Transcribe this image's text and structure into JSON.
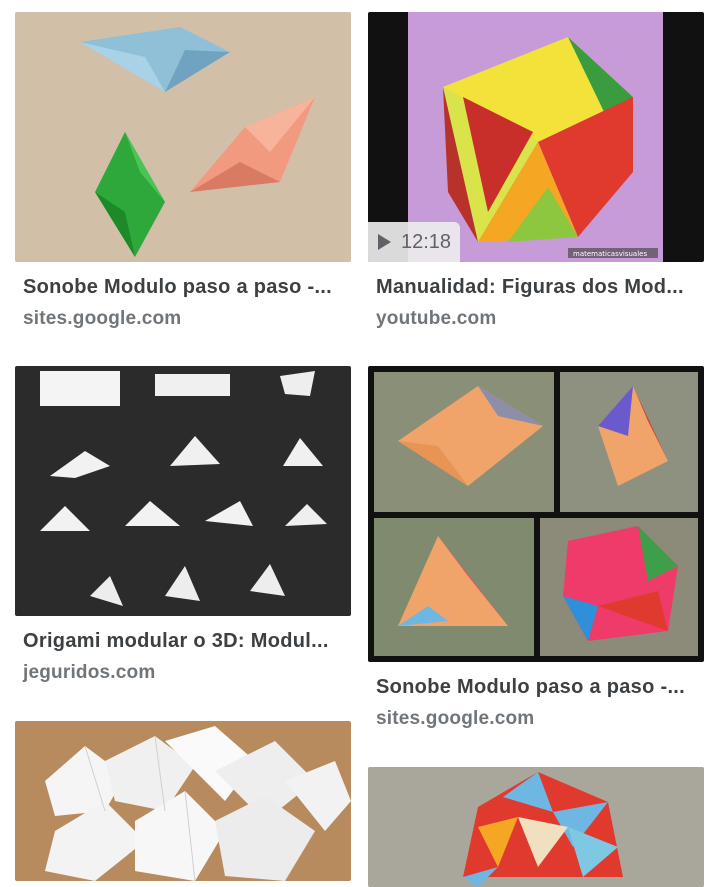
{
  "results": [
    {
      "title": "Sonobe Modulo paso a paso -...",
      "source": "sites.google.com"
    },
    {
      "title": "Manualidad: Figuras dos Mod...",
      "source": "youtube.com",
      "duration": "12:18",
      "watermark": "matematicasvisuales"
    },
    {
      "title": "Origami modular o 3D: Modul...",
      "source": "jeguridos.com"
    },
    {
      "title": "Sonobe Modulo paso a paso -...",
      "source": "sites.google.com"
    }
  ],
  "colors": {
    "title": "#3c4043",
    "source": "#70757a",
    "purple_bg": "#c79bd8",
    "dark_bg": "#2b2b2b"
  }
}
